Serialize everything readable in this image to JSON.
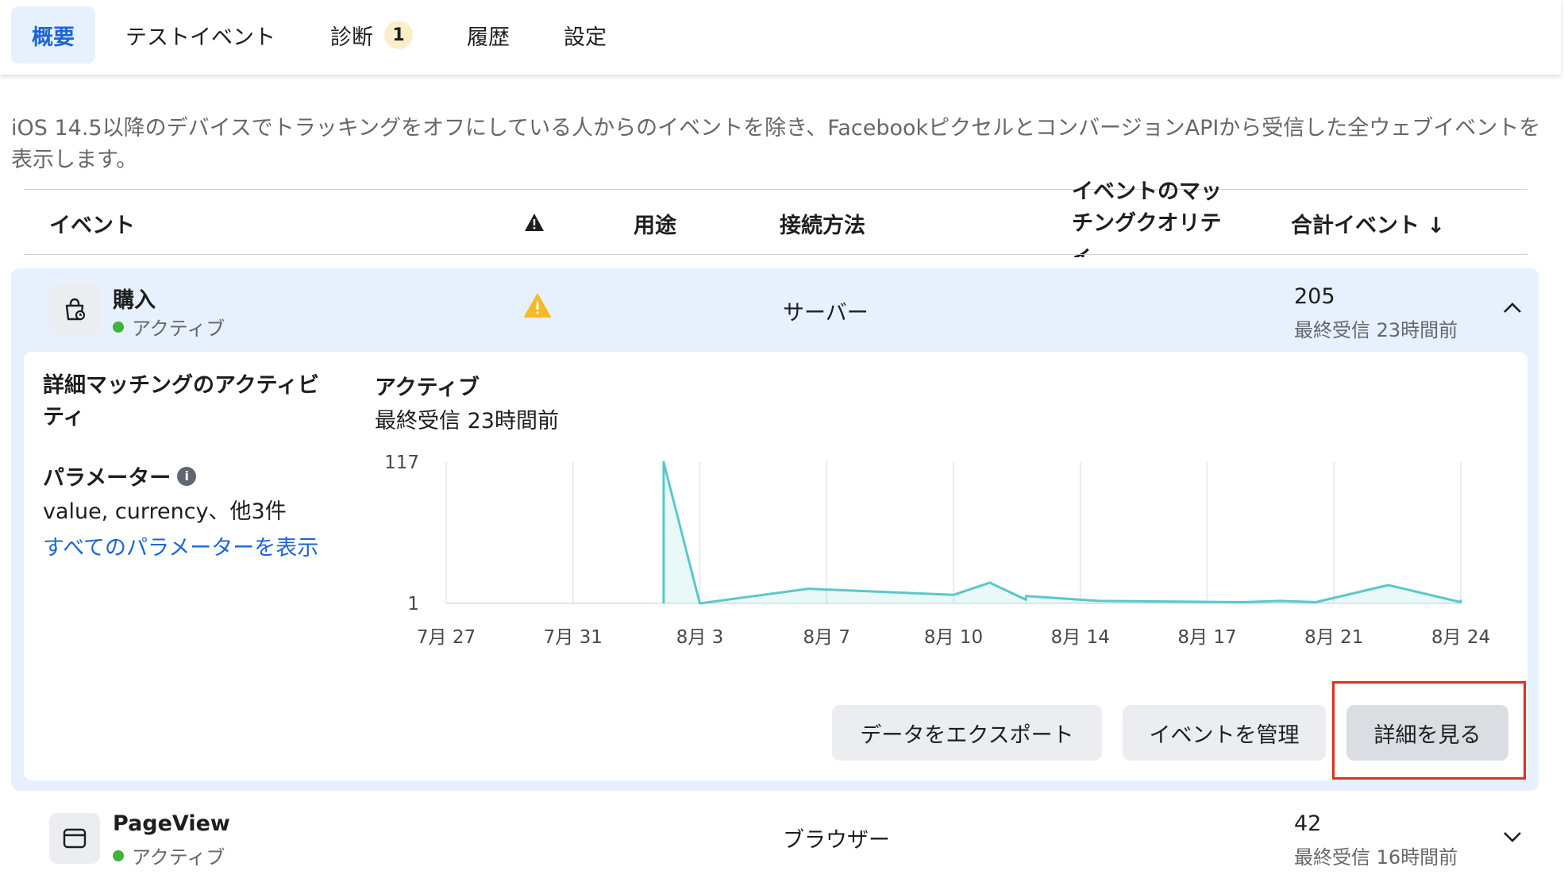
{
  "tabs": [
    {
      "label": "概要"
    },
    {
      "label": "テストイベント"
    },
    {
      "label": "診断",
      "badge": "1"
    },
    {
      "label": "履歴"
    },
    {
      "label": "設定"
    }
  ],
  "intro": "iOS 14.5以降のデバイスでトラッキングをオフにしている人からのイベントを除き、Facebookピクセルとコンバージョンから受信した全ウェブイベントを表示します。",
  "intro_full": "iOS 14.5以降のデバイスでトラッキングをオフにしている人からのイベントを除き、FacebookピクセルとコンバージョンAPIから受信した全ウェブイベントを表示します。",
  "table": {
    "headers": {
      "event": "イベント",
      "usage": "用途",
      "connection": "接続方法",
      "quality": "イベントのマッチングクオリティ",
      "total": "合計イベント ↓"
    },
    "rows": [
      {
        "name": "購入",
        "status": "アクティブ",
        "connection": "サーバー",
        "total": "205",
        "last_received": "最終受信 23時間前",
        "icon": "shopping-bag-icon",
        "warning": true,
        "expanded": true
      },
      {
        "name": "PageView",
        "status": "アクティブ",
        "connection": "ブラウザー",
        "total": "42",
        "last_received": "最終受信 16時間前",
        "icon": "browser-window-icon",
        "warning": false,
        "expanded": false
      }
    ]
  },
  "detail": {
    "advanced_matching_label": "詳細マッチングのアクティビティ",
    "parameters_label": "パラメーター",
    "parameters_value": "value, currency、他3件",
    "show_all_parameters": "すべてのパラメーターを表示",
    "activity_status": "アクティブ",
    "activity_last_received": "最終受信 23時間前",
    "buttons": {
      "export": "データをエクスポート",
      "manage": "イベントを管理",
      "details": "詳細を見る"
    }
  },
  "colors": {
    "accent": "#1b66d6",
    "active_tab_bg": "#e7f0fd",
    "chart_line": "#5bc8c9",
    "status_green": "#3fb33b",
    "warning": "#f7b928",
    "highlight_border": "#e0301e"
  },
  "chart_data": {
    "type": "area",
    "x_tick_labels": [
      "7月 27",
      "7月 31",
      "8月 3",
      "8月 7",
      "8月 10",
      "8月 14",
      "8月 17",
      "8月 21",
      "8月 24"
    ],
    "y_tick_labels": [
      "117",
      "1"
    ],
    "ylim": [
      1,
      117
    ],
    "xlim": [
      "2021-07-27",
      "2021-08-24"
    ],
    "series": [
      {
        "points": [
          [
            "2021-08-02",
            1
          ],
          [
            "2021-08-02",
            117
          ],
          [
            "2021-08-03",
            1
          ],
          [
            "2021-08-06",
            13
          ],
          [
            "2021-08-10",
            8
          ],
          [
            "2021-08-11",
            18
          ],
          [
            "2021-08-12",
            4
          ],
          [
            "2021-08-12",
            7
          ],
          [
            "2021-08-14",
            3
          ],
          [
            "2021-08-18",
            2
          ],
          [
            "2021-08-19",
            3
          ],
          [
            "2021-08-20",
            2
          ],
          [
            "2021-08-22",
            16
          ],
          [
            "2021-08-24",
            2
          ],
          [
            "2021-08-24",
            4
          ]
        ]
      }
    ],
    "grid": true
  }
}
